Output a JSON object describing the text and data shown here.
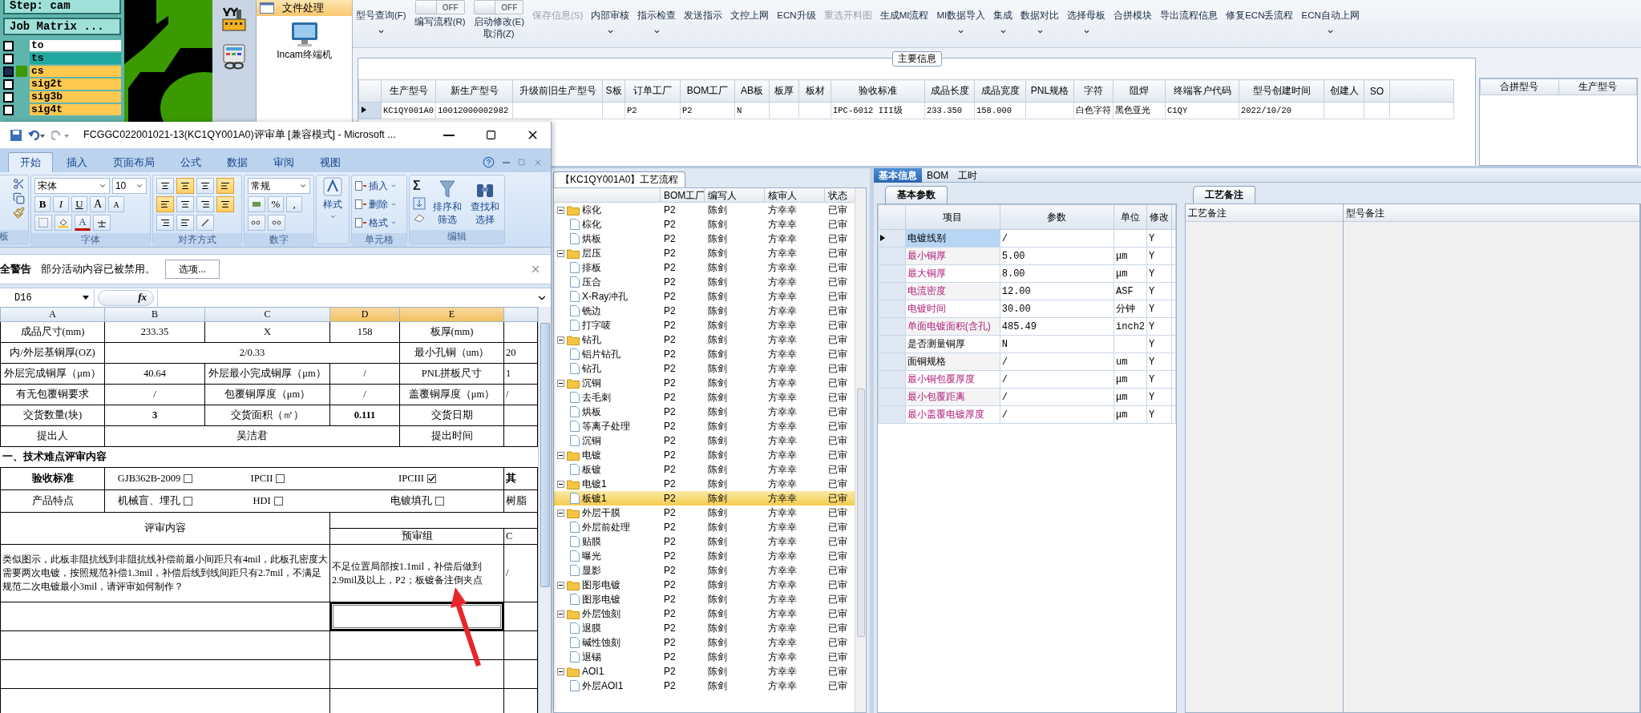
{
  "cam": {
    "step": "Step: cam",
    "job_matrix": "Job Matrix ...",
    "layers": [
      {
        "name": "to",
        "color": "#ffffff",
        "selected": false
      },
      {
        "name": "ts",
        "color": "#20a8a0",
        "selected": false
      },
      {
        "name": "cs",
        "color": "#ffc850",
        "selected": true
      },
      {
        "name": "sig2t",
        "color": "#ffc850",
        "selected": false
      },
      {
        "name": "sig3b",
        "color": "#ffc850",
        "selected": false
      },
      {
        "name": "sig4t",
        "color": "#ffc850",
        "selected": false
      }
    ]
  },
  "file_panel": {
    "title": "文件处理",
    "items": [
      "Incam终端机"
    ]
  },
  "toolbar": [
    {
      "kind": "button",
      "label": "型号查询(F)",
      "disabled": false,
      "dropdown": true
    },
    {
      "kind": "toggle",
      "label": "编写流程(R)",
      "state_label": "OFF",
      "on": false,
      "disabled": false
    },
    {
      "kind": "toggle",
      "label": "启动修改(E)\n取消(Z)",
      "state_label": "OFF",
      "on": false,
      "disabled": false
    },
    {
      "kind": "button",
      "label": "保存信息(S)",
      "disabled": true,
      "dropdown": false
    },
    {
      "kind": "button",
      "label": "内部审核",
      "disabled": false,
      "dropdown": true
    },
    {
      "kind": "button",
      "label": "指示检查",
      "disabled": false,
      "dropdown": true
    },
    {
      "kind": "button",
      "label": "发送指示",
      "disabled": false,
      "dropdown": false
    },
    {
      "kind": "button",
      "label": "文控上网",
      "disabled": false,
      "dropdown": false
    },
    {
      "kind": "button",
      "label": "ECN升级",
      "disabled": false,
      "dropdown": false
    },
    {
      "kind": "button",
      "label": "重选开料图",
      "disabled": true,
      "dropdown": false
    },
    {
      "kind": "button",
      "label": "生成MI流程",
      "disabled": false,
      "dropdown": false
    },
    {
      "kind": "button",
      "label": "MI数据导入",
      "disabled": false,
      "dropdown": true
    },
    {
      "kind": "button",
      "label": "集成",
      "disabled": false,
      "dropdown": true
    },
    {
      "kind": "button",
      "label": "数据对比",
      "disabled": false,
      "dropdown": true
    },
    {
      "kind": "button",
      "label": "选择母板",
      "disabled": false,
      "dropdown": true
    },
    {
      "kind": "button",
      "label": "合拼模块",
      "disabled": false,
      "dropdown": false
    },
    {
      "kind": "button",
      "label": "导出流程信息",
      "disabled": false,
      "dropdown": false
    },
    {
      "kind": "button",
      "label": "修复ECN丢流程",
      "disabled": false,
      "dropdown": false
    },
    {
      "kind": "button",
      "label": "ECN自动上网",
      "disabled": false,
      "dropdown": true
    }
  ],
  "main_info": {
    "title": "主要信息",
    "columns": [
      "生产型号",
      "新生产型号",
      "升级前旧生产型号",
      "S板",
      "订单工厂",
      "BOM工厂",
      "AB板",
      "板厚",
      "板材",
      "验收标准",
      "成品长度",
      "成品宽度",
      "PNL规格",
      "字符",
      "阻焊",
      "终端客户代码",
      "型号创建时间",
      "创建人",
      "SO"
    ],
    "rows": [
      {
        "selected": true,
        "cells": [
          "KC1QY001A0",
          "10012000002982",
          "",
          "",
          "P2",
          "P2",
          "N",
          "",
          "",
          "IPC-6012 III级",
          "233.350",
          "158.000",
          "",
          "白色字符",
          "黑色亚光",
          "C1QY",
          "2022/10/20",
          "",
          ""
        ]
      }
    ]
  },
  "merge_table": {
    "columns": [
      "合拼型号",
      "生产型号"
    ]
  },
  "excel": {
    "title": "FCGGC022001021-13(KC1QY001A0)评审单  [兼容模式]  -  Microsoft ...",
    "tabs": [
      {
        "label": "开始",
        "selected": true
      },
      {
        "label": "插入",
        "selected": false
      },
      {
        "label": "页面布局",
        "selected": false
      },
      {
        "label": "公式",
        "selected": false
      },
      {
        "label": "数据",
        "selected": false
      },
      {
        "label": "审阅",
        "selected": false
      },
      {
        "label": "视图",
        "selected": false
      }
    ],
    "ribbon": {
      "clipboard_label": "板",
      "font_name": "宋体",
      "font_size": "10",
      "font_buttons": [
        "B",
        "I",
        "U"
      ],
      "grow_buttons": [
        "A",
        "A"
      ],
      "font_color": "A",
      "font_label": "字体",
      "align_label": "对齐方式",
      "number_format": "常规",
      "number_buttons": [
        "%",
        ","
      ],
      "number_label": "数字",
      "styles_label": "样式",
      "cell_items": [
        "插入",
        "删除",
        "格式"
      ],
      "cells_label": "单元格",
      "sum": "Σ",
      "sort_lines": [
        "排序和",
        "筛选"
      ],
      "find_lines": [
        "查找和",
        "选择"
      ],
      "edit_label": "编辑"
    },
    "security": {
      "title": "全警告",
      "message": "部分活动内容已被禁用。",
      "button": "选项..."
    },
    "name_box": "D16",
    "fx": "fx",
    "column_headers": [
      {
        "label": "A",
        "selected": false
      },
      {
        "label": "B",
        "selected": false
      },
      {
        "label": "C",
        "selected": false
      },
      {
        "label": "D",
        "selected": true
      },
      {
        "label": "E",
        "selected": true
      }
    ],
    "rows": [
      {
        "kind": "cells",
        "cells": [
          {
            "text": "成品尺寸(mm)"
          },
          {
            "text": "233.35"
          },
          {
            "text": "X"
          },
          {
            "text": "158"
          },
          {
            "text": "板厚(mm)"
          },
          {
            "text": ""
          }
        ]
      },
      {
        "kind": "merged",
        "cells": [
          {
            "text": "内/外层基铜厚(OZ)"
          },
          {
            "text": "2/0.33"
          },
          {
            "text": "最小孔铜（um）"
          },
          {
            "text": "20"
          }
        ]
      },
      {
        "kind": "cells",
        "cells": [
          {
            "text": "外层完成铜厚（μm）"
          },
          {
            "text": "40.64"
          },
          {
            "text": "外层最小完成铜厚（μm）"
          },
          {
            "text": "/"
          },
          {
            "text": "PNL拼板尺寸"
          },
          {
            "text": "1"
          }
        ]
      },
      {
        "kind": "cells",
        "cells": [
          {
            "text": "有无包覆铜要求"
          },
          {
            "text": "/"
          },
          {
            "text": "包覆铜厚度（μm）"
          },
          {
            "text": "/"
          },
          {
            "text": "盖覆铜厚度（μm）"
          },
          {
            "text": "/"
          }
        ]
      },
      {
        "kind": "cells",
        "cells": [
          {
            "text": "交货数量(块)"
          },
          {
            "text": "3",
            "bold": true
          },
          {
            "text": "交货面积（㎡）"
          },
          {
            "text": "0.111",
            "bold": true
          },
          {
            "text": "交货日期"
          },
          {
            "text": ""
          }
        ]
      },
      {
        "kind": "merged",
        "cells": [
          {
            "text": "提出人"
          },
          {
            "text": "吴洁君"
          },
          {
            "text": "提出时间"
          },
          {
            "text": ""
          }
        ]
      },
      {
        "kind": "section",
        "text": "一、技术难点评审内容"
      },
      {
        "kind": "checks",
        "label": "验收标准",
        "bold": true,
        "items": [
          {
            "label": "GJB362B-2009",
            "checked": false
          },
          {
            "label": "IPCII",
            "checked": false
          },
          {
            "label": "IPCIII",
            "checked": true
          }
        ],
        "extra": "其"
      },
      {
        "kind": "checks",
        "label": "产品特点",
        "bold": false,
        "items": [
          {
            "label": "机械盲、埋孔",
            "checked": false
          },
          {
            "label": "HDI",
            "checked": false
          },
          {
            "label": "电镀填孔",
            "checked": false
          }
        ],
        "extra": "树脂"
      },
      {
        "kind": "review_header",
        "title": "评审内容",
        "group": "预审组",
        "extra": "C"
      },
      {
        "kind": "review",
        "question": "类似图示，此板非阻抗线到非阻抗线补偿前最小间距只有4mil，此板孔密度大需要两次电镀，按照规范补偿1.3mil，补偿后线到线间距只有2.7mil，不满足规范二次电镀最小3mil，请评审如何制作？",
        "answer": "不足位置局部按1.1mil，补偿后做到2.9mil及以上，P2；板镀备注倒夹点",
        "extra": "/"
      },
      {
        "kind": "empty",
        "selected": true
      },
      {
        "kind": "empty",
        "selected": false
      },
      {
        "kind": "empty",
        "selected": false
      },
      {
        "kind": "empty",
        "selected": false
      }
    ]
  },
  "process_tree": {
    "tab": "【KC1QY001A0】工艺流程",
    "columns": [
      "BOM工厂",
      "编写人",
      "核审人",
      "状态"
    ],
    "groups": [
      {
        "name": "棕化",
        "expanded": true,
        "cells": [
          "P2",
          "陈剑",
          "方幸幸",
          "已审"
        ],
        "children": [
          {
            "name": "棕化",
            "selected": false,
            "cells": [
              "P2",
              "陈剑",
              "方幸幸",
              "已审"
            ]
          },
          {
            "name": "烘板",
            "selected": false,
            "cells": [
              "P2",
              "陈剑",
              "方幸幸",
              "已审"
            ]
          }
        ]
      },
      {
        "name": "层压",
        "expanded": true,
        "cells": [
          "P2",
          "陈剑",
          "方幸幸",
          "已审"
        ],
        "children": [
          {
            "name": "排板",
            "selected": false,
            "cells": [
              "P2",
              "陈剑",
              "方幸幸",
              "已审"
            ]
          },
          {
            "name": "压合",
            "selected": false,
            "cells": [
              "P2",
              "陈剑",
              "方幸幸",
              "已审"
            ]
          },
          {
            "name": "X-Ray冲孔",
            "selected": false,
            "cells": [
              "P2",
              "陈剑",
              "方幸幸",
              "已审"
            ]
          },
          {
            "name": "铣边",
            "selected": false,
            "cells": [
              "P2",
              "陈剑",
              "方幸幸",
              "已审"
            ]
          },
          {
            "name": "打字唛",
            "selected": false,
            "cells": [
              "P2",
              "陈剑",
              "方幸幸",
              "已审"
            ]
          }
        ]
      },
      {
        "name": "钻孔",
        "expanded": true,
        "cells": [
          "P2",
          "陈剑",
          "方幸幸",
          "已审"
        ],
        "children": [
          {
            "name": "铝片钻孔",
            "selected": false,
            "cells": [
              "P2",
              "陈剑",
              "方幸幸",
              "已审"
            ]
          },
          {
            "name": "钻孔",
            "selected": false,
            "cells": [
              "P2",
              "陈剑",
              "方幸幸",
              "已审"
            ]
          }
        ]
      },
      {
        "name": "沉铜",
        "expanded": true,
        "cells": [
          "P2",
          "陈剑",
          "方幸幸",
          "已审"
        ],
        "children": [
          {
            "name": "去毛刺",
            "selected": false,
            "cells": [
              "P2",
              "陈剑",
              "方幸幸",
              "已审"
            ]
          },
          {
            "name": "烘板",
            "selected": false,
            "cells": [
              "P2",
              "陈剑",
              "方幸幸",
              "已审"
            ]
          },
          {
            "name": "等离子处理",
            "selected": false,
            "cells": [
              "P2",
              "陈剑",
              "方幸幸",
              "已审"
            ]
          },
          {
            "name": "沉铜",
            "selected": false,
            "cells": [
              "P2",
              "陈剑",
              "方幸幸",
              "已审"
            ]
          }
        ]
      },
      {
        "name": "电镀",
        "expanded": true,
        "cells": [
          "P2",
          "陈剑",
          "方幸幸",
          "已审"
        ],
        "children": [
          {
            "name": "板镀",
            "selected": false,
            "cells": [
              "P2",
              "陈剑",
              "方幸幸",
              "已审"
            ]
          }
        ]
      },
      {
        "name": "电镀1",
        "expanded": true,
        "cells": [
          "P2",
          "陈剑",
          "方幸幸",
          "已审"
        ],
        "children": [
          {
            "name": "板镀1",
            "selected": true,
            "cells": [
              "P2",
              "陈剑",
              "方幸幸",
              "已审"
            ]
          }
        ]
      },
      {
        "name": "外层干膜",
        "expanded": true,
        "cells": [
          "P2",
          "陈剑",
          "方幸幸",
          "已审"
        ],
        "children": [
          {
            "name": "外层前处理",
            "selected": false,
            "cells": [
              "P2",
              "陈剑",
              "方幸幸",
              "已审"
            ]
          },
          {
            "name": "贴膜",
            "selected": false,
            "cells": [
              "P2",
              "陈剑",
              "方幸幸",
              "已审"
            ]
          },
          {
            "name": "曝光",
            "selected": false,
            "cells": [
              "P2",
              "陈剑",
              "方幸幸",
              "已审"
            ]
          },
          {
            "name": "显影",
            "selected": false,
            "cells": [
              "P2",
              "陈剑",
              "方幸幸",
              "已审"
            ]
          }
        ]
      },
      {
        "name": "图形电镀",
        "expanded": true,
        "cells": [
          "P2",
          "陈剑",
          "方幸幸",
          "已审"
        ],
        "children": [
          {
            "name": "图形电镀",
            "selected": false,
            "cells": [
              "P2",
              "陈剑",
              "方幸幸",
              "已审"
            ]
          }
        ]
      },
      {
        "name": "外层蚀刻",
        "expanded": true,
        "cells": [
          "P2",
          "陈剑",
          "方幸幸",
          "已审"
        ],
        "children": [
          {
            "name": "退膜",
            "selected": false,
            "cells": [
              "P2",
              "陈剑",
              "方幸幸",
              "已审"
            ]
          },
          {
            "name": "碱性蚀刻",
            "selected": false,
            "cells": [
              "P2",
              "陈剑",
              "方幸幸",
              "已审"
            ]
          },
          {
            "name": "退锡",
            "selected": false,
            "cells": [
              "P2",
              "陈剑",
              "方幸幸",
              "已审"
            ]
          }
        ]
      },
      {
        "name": "AOI1",
        "expanded": true,
        "cells": [
          "P2",
          "陈剑",
          "方幸幸",
          "已审"
        ],
        "children": [
          {
            "name": "外层AOI1",
            "selected": false,
            "cells": [
              "P2",
              "陈剑",
              "方幸幸",
              "已审"
            ]
          }
        ]
      }
    ]
  },
  "details": {
    "tabs": [
      {
        "label": "基本信息",
        "selected": true
      },
      {
        "label": "BOM",
        "selected": false
      },
      {
        "label": "工时",
        "selected": false
      }
    ],
    "params": {
      "tab": "基本参数",
      "columns": [
        "项目",
        "参数",
        "单位",
        "修改"
      ],
      "rows": [
        {
          "name": "电镀线别",
          "value": "/",
          "unit": "",
          "modify": "Y",
          "highlighted": false,
          "selected": true
        },
        {
          "name": "最小铜厚",
          "value": "5.00",
          "unit": "μm",
          "modify": "Y",
          "highlighted": true,
          "selected": false
        },
        {
          "name": "最大铜厚",
          "value": "8.00",
          "unit": "μm",
          "modify": "Y",
          "highlighted": true,
          "selected": false
        },
        {
          "name": "电流密度",
          "value": "12.00",
          "unit": "ASF",
          "modify": "Y",
          "highlighted": true,
          "selected": false
        },
        {
          "name": "电镀时间",
          "value": "30.00",
          "unit": "分钟",
          "modify": "Y",
          "highlighted": true,
          "selected": false
        },
        {
          "name": "单面电镀面积(含孔)",
          "value": "485.49",
          "unit": "inch2",
          "modify": "Y",
          "highlighted": true,
          "selected": false
        },
        {
          "name": "是否测量铜厚",
          "value": "N",
          "unit": "",
          "modify": "Y",
          "highlighted": false,
          "selected": false
        },
        {
          "name": "面铜规格",
          "value": "/",
          "unit": "um",
          "modify": "Y",
          "highlighted": false,
          "selected": false
        },
        {
          "name": "最小铜包覆厚度",
          "value": "/",
          "unit": "μm",
          "modify": "Y",
          "highlighted": true,
          "selected": false
        },
        {
          "name": "最小包覆距离",
          "value": "/",
          "unit": "μm",
          "modify": "Y",
          "highlighted": true,
          "selected": false
        },
        {
          "name": "最小盖覆电镀厚度",
          "value": "/",
          "unit": "μm",
          "modify": "Y",
          "highlighted": true,
          "selected": false
        }
      ]
    },
    "notes": {
      "tab": "工艺备注",
      "columns": [
        "工艺备注",
        "型号备注"
      ]
    }
  }
}
